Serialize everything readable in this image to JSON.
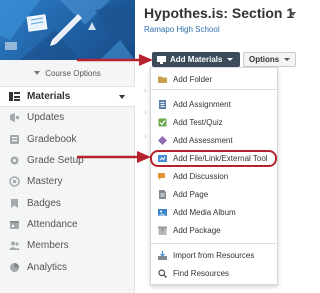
{
  "course": {
    "title": "Hypothes.is: Section 1",
    "school": "Ramapo High School",
    "options_label": "Course Options"
  },
  "sidebar": {
    "items": [
      {
        "label": "Materials",
        "icon": "materials-icon",
        "active": true
      },
      {
        "label": "Updates",
        "icon": "updates-icon"
      },
      {
        "label": "Gradebook",
        "icon": "gradebook-icon"
      },
      {
        "label": "Grade Setup",
        "icon": "grade-setup-icon"
      },
      {
        "label": "Mastery",
        "icon": "mastery-icon"
      },
      {
        "label": "Badges",
        "icon": "badges-icon"
      },
      {
        "label": "Attendance",
        "icon": "attendance-icon"
      },
      {
        "label": "Members",
        "icon": "members-icon"
      },
      {
        "label": "Analytics",
        "icon": "analytics-icon"
      }
    ]
  },
  "toolbar": {
    "add_materials_label": "Add Materials",
    "options_label": "Options"
  },
  "add_menu": {
    "items": [
      {
        "label": "Add Folder",
        "icon": "folder-icon"
      },
      {
        "label": "Add Assignment",
        "icon": "assignment-icon"
      },
      {
        "label": "Add Test/Quiz",
        "icon": "test-quiz-icon"
      },
      {
        "label": "Add Assessment",
        "icon": "assessment-icon"
      },
      {
        "label": "Add File/Link/External Tool",
        "icon": "link-icon",
        "highlighted": true
      },
      {
        "label": "Add Discussion",
        "icon": "discussion-icon"
      },
      {
        "label": "Add Page",
        "icon": "page-icon"
      },
      {
        "label": "Add Media Album",
        "icon": "media-album-icon"
      },
      {
        "label": "Add Package",
        "icon": "package-icon"
      },
      {
        "label": "Import from Resources",
        "icon": "import-icon"
      },
      {
        "label": "Find Resources",
        "icon": "find-resources-icon"
      }
    ]
  },
  "colors": {
    "annotation_red": "#b5232f",
    "button_dark": "#3b4b5a",
    "banner_blue": "#2f7fc7",
    "link_blue": "#2f6fad"
  }
}
